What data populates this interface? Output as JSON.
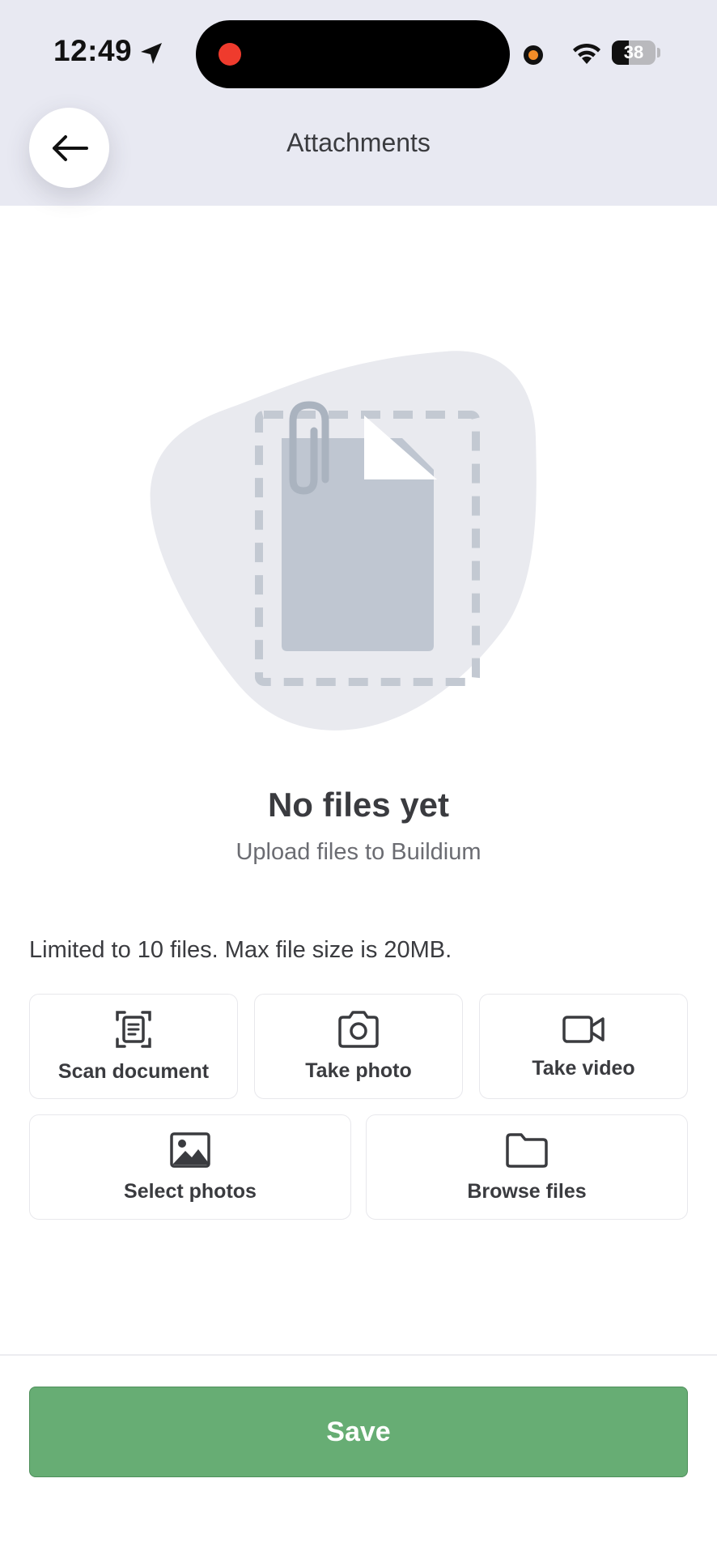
{
  "status_bar": {
    "time": "12:49",
    "battery_level": "38",
    "battery_fraction": 0.38,
    "icons": [
      "location-arrow-icon",
      "recording-indicator-icon",
      "camera-in-use-indicator-icon",
      "wifi-icon",
      "battery-icon"
    ]
  },
  "header": {
    "title": "Attachments",
    "back_icon": "arrow-left-icon"
  },
  "empty_state": {
    "illustration": "document-with-paperclip-illustration",
    "title": "No files yet",
    "subtitle": "Upload files to Buildium"
  },
  "upload": {
    "limit_text": "Limited to 10 files. Max file size is 20MB.",
    "options": [
      {
        "label": "Scan document",
        "icon": "scan-document-icon"
      },
      {
        "label": "Take photo",
        "icon": "camera-icon"
      },
      {
        "label": "Take video",
        "icon": "video-camera-icon"
      },
      {
        "label": "Select photos",
        "icon": "image-icon"
      },
      {
        "label": "Browse files",
        "icon": "folder-icon"
      }
    ]
  },
  "footer": {
    "save_label": "Save"
  },
  "colors": {
    "header_bg": "#e8e9f2",
    "primary_green": "#67ad74",
    "illustration_blob": "#e9eaef",
    "illustration_doc": "#c0c7d1",
    "text_primary": "#3a3b3f",
    "text_secondary": "#6b6c72"
  }
}
